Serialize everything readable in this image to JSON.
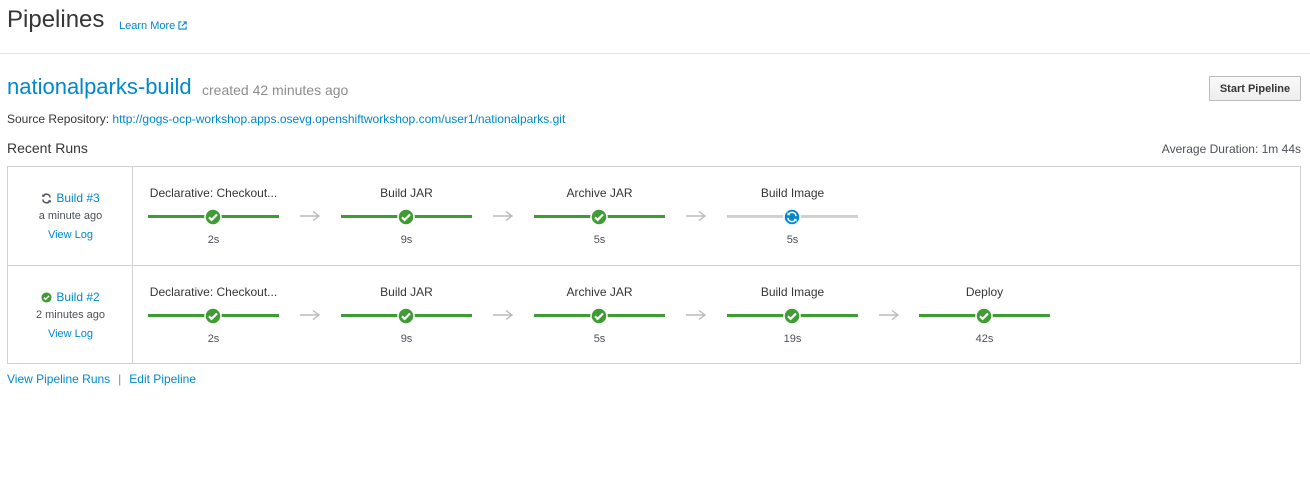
{
  "header": {
    "title": "Pipelines",
    "learn_more": "Learn More"
  },
  "pipeline": {
    "name": "nationalparks-build",
    "created": "created 42 minutes ago",
    "start_button": "Start Pipeline",
    "source_label": "Source Repository:",
    "source_url": "http://gogs-ocp-workshop.apps.osevg.openshiftworkshop.com/user1/nationalparks.git"
  },
  "recent_runs": {
    "title": "Recent Runs",
    "avg_duration": "Average Duration: 1m 44s"
  },
  "runs": [
    {
      "build": "Build #3",
      "status": "running",
      "time": "a minute ago",
      "view_log": "View Log",
      "stages": [
        {
          "name": "Declarative: Checkout...",
          "duration": "2s",
          "status": "success"
        },
        {
          "name": "Build JAR",
          "duration": "9s",
          "status": "success"
        },
        {
          "name": "Archive JAR",
          "duration": "5s",
          "status": "success"
        },
        {
          "name": "Build Image",
          "duration": "5s",
          "status": "running"
        }
      ]
    },
    {
      "build": "Build #2",
      "status": "success",
      "time": "2 minutes ago",
      "view_log": "View Log",
      "stages": [
        {
          "name": "Declarative: Checkout...",
          "duration": "2s",
          "status": "success"
        },
        {
          "name": "Build JAR",
          "duration": "9s",
          "status": "success"
        },
        {
          "name": "Archive JAR",
          "duration": "5s",
          "status": "success"
        },
        {
          "name": "Build Image",
          "duration": "19s",
          "status": "success"
        },
        {
          "name": "Deploy",
          "duration": "42s",
          "status": "success"
        }
      ]
    }
  ],
  "footer": {
    "view_runs": "View Pipeline Runs",
    "separator": "|",
    "edit": "Edit Pipeline"
  },
  "colors": {
    "link": "#0088ce",
    "success": "#3f9c35",
    "running": "#0088ce",
    "border": "#d1d1d1"
  },
  "icons": {
    "external": "external-link-icon",
    "running": "sync-icon",
    "success": "check-circle-icon",
    "arrow": "arrow-right-icon"
  }
}
